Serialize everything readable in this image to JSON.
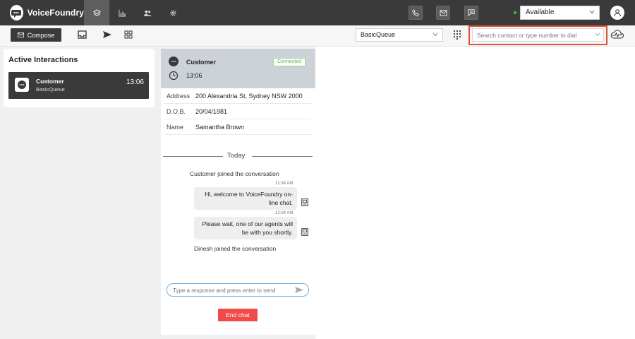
{
  "app": {
    "name": "VoiceFoundry"
  },
  "nav": {
    "tabs": [
      {
        "name": "layers-icon",
        "active": true
      },
      {
        "name": "bar-chart-icon",
        "active": false
      },
      {
        "name": "users-icon",
        "active": false
      },
      {
        "name": "gear-icon",
        "active": false
      }
    ]
  },
  "topbar": {
    "status": {
      "value": "Available",
      "color": "#3cc04a"
    },
    "actions": [
      "phone-icon",
      "mail-icon",
      "chat-icon"
    ]
  },
  "toolbar": {
    "compose_label": "Compose",
    "queue_value": "BasicQueue",
    "search_placeholder": "Search contact or type number to dial"
  },
  "active_interactions": {
    "title": "Active Interactions",
    "items": [
      {
        "name": "Customer",
        "queue": "BasicQueue",
        "time": "13:06"
      }
    ]
  },
  "conversation": {
    "header": {
      "name": "Customer",
      "status": "Connected",
      "time": "13:06"
    },
    "info": [
      {
        "label": "Address",
        "value": "200 Alexandria St, Sydney NSW 2000"
      },
      {
        "label": "D.O.B.",
        "value": "20/04/1981"
      },
      {
        "label": "Name",
        "value": "Samantha Brown"
      }
    ],
    "divider_label": "Today",
    "messages": {
      "sys_join_customer": "Customer joined the conversation",
      "bot1_time": "12:34 AM",
      "bot1_line1": "Hi, welcome to VoiceFoundry on-",
      "bot1_line2": "line chat.",
      "bot2_time": "12:34 AM",
      "bot2_line1": "Please wait, one of our agents will",
      "bot2_line2": "be with you shortly.",
      "sys_join_agent": "Dinesh joined the conversation"
    },
    "reply_placeholder": "Type a response and press enter to send",
    "end_chat_label": "End chat"
  },
  "colors": {
    "topbar": "#3a3a3a",
    "accent_red": "#f04b4b",
    "highlight": "#e0503c",
    "connected_green": "#58b350"
  }
}
